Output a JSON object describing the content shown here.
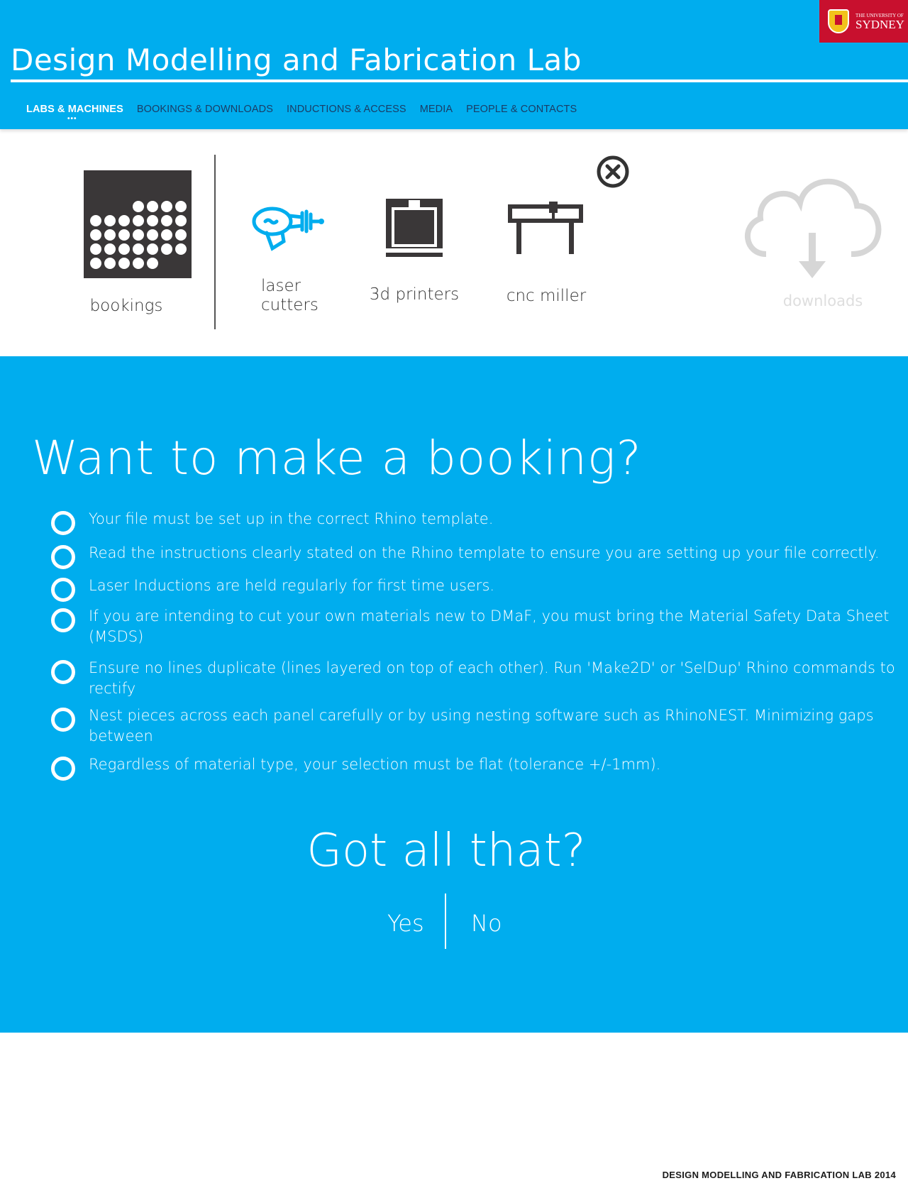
{
  "header": {
    "site_title": "Design Modelling and Fabrication Lab",
    "logo": {
      "small": "THE UNIVERSITY OF",
      "big": "SYDNEY"
    },
    "bg_color": "#00adee"
  },
  "nav": {
    "items": [
      {
        "label": "LABS & MACHINES",
        "active": true
      },
      {
        "label": "BOOKINGS & DOWNLOADS",
        "active": false
      },
      {
        "label": "INDUCTIONS & ACCESS",
        "active": false
      },
      {
        "label": "MEDIA",
        "active": false
      },
      {
        "label": "PEOPLE & CONTACTS",
        "active": false
      }
    ],
    "active_indicator": "•••"
  },
  "machines": {
    "bookings": {
      "label": "bookings",
      "icon": "calendar-grid-icon"
    },
    "laser": {
      "label_line1": "laser",
      "label_line2": "cutters",
      "icon": "laser-gun-icon"
    },
    "printers": {
      "label": "3d printers",
      "icon": "3d-printer-icon"
    },
    "cnc": {
      "label": "cnc miller",
      "icon": "cnc-miller-icon"
    },
    "downloads": {
      "label": "downloads",
      "icon": "cloud-download-icon"
    },
    "close_icon": "close-circle-icon"
  },
  "booking": {
    "title": "Want to make a booking?",
    "rules": [
      "Your file must be set up in the correct Rhino template.",
      "Read the instructions clearly stated on the Rhino template to ensure you are setting up your file correctly.",
      "Laser Inductions are held regularly for first time users.",
      "If you are intending to cut your own materials new to DMaF, you must bring the Material Safety Data Sheet (MSDS)",
      "Ensure no lines duplicate (lines layered on top of each other). Run 'Make2D' or 'SelDup' Rhino commands to rectify",
      "Nest pieces across each panel carefully or by using nesting software such as RhinoNEST. Minimizing gaps between",
      "Regardless of material type, your selection must be flat (tolerance +/-1mm)."
    ],
    "confirm_question": "Got all that?",
    "yes_label": "Yes",
    "no_label": "No"
  },
  "footer": {
    "text": "DESIGN MODELLING AND FABRICATION LAB 2014"
  }
}
